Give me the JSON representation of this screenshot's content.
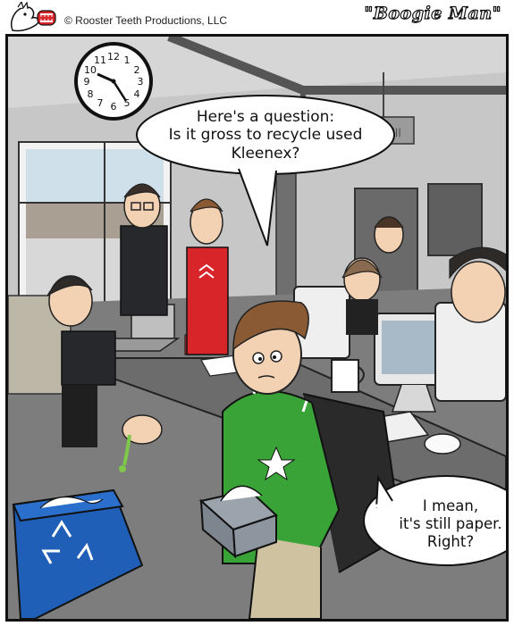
{
  "header": {
    "copyright": "© Rooster Teeth Productions, LLC",
    "title": "\"Boogie Man\""
  },
  "bubbles": {
    "top": [
      "Here's a question:",
      "Is it gross to recycle used",
      "Kleenex?"
    ],
    "bottom": [
      "I mean,",
      "it's still paper.",
      "Right?"
    ]
  },
  "clock": {
    "numerals": [
      "12",
      "1",
      "2",
      "3",
      "4",
      "5",
      "6",
      "7",
      "8",
      "9",
      "10",
      "11"
    ]
  },
  "colors": {
    "wall": "#c9c9c9",
    "floor": "#7d7d7d",
    "green_shirt": "#3aa337",
    "red_shirt": "#d8252a",
    "recycle_bin": "#1f5fb8",
    "desk": "#6c6c6c"
  }
}
